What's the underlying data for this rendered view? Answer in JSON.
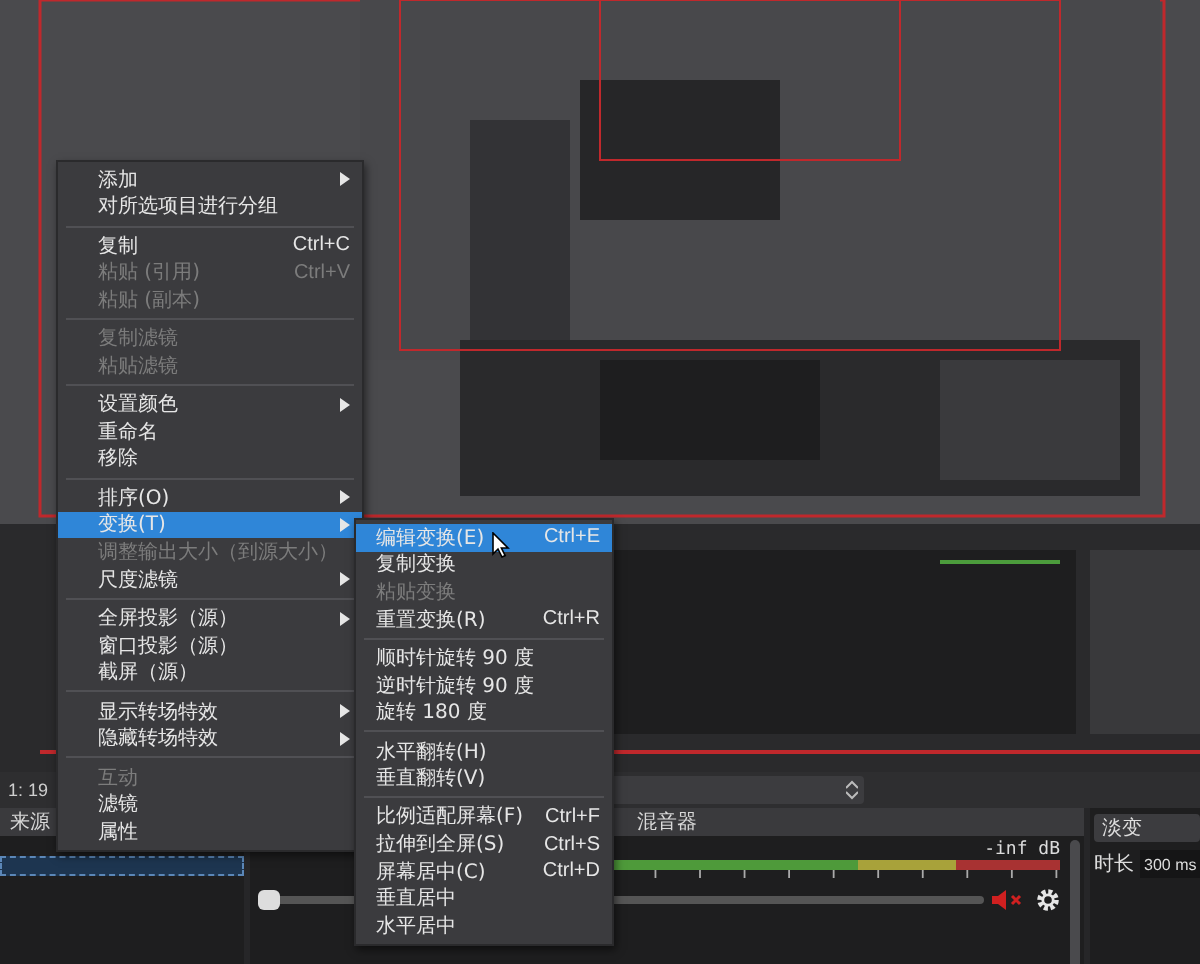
{
  "toolbar": {
    "scene_label": "1: 19"
  },
  "docks": {
    "sources": {
      "title": "来源"
    },
    "mixer": {
      "title": "混音器",
      "reading": "-inf dB",
      "level": 0,
      "muted": true
    },
    "transitions": {
      "transition": "淡变",
      "duration_label": "时长",
      "duration": "300 ms"
    }
  },
  "context_menu": {
    "items": [
      {
        "kind": "item",
        "label": "添加",
        "has_submenu": true,
        "disabled": false,
        "selected": false
      },
      {
        "kind": "item",
        "label": "对所选项目进行分组",
        "has_submenu": false,
        "disabled": false,
        "selected": false
      },
      {
        "kind": "separator"
      },
      {
        "kind": "item",
        "label": "复制",
        "shortcut": "Ctrl+C",
        "has_submenu": false,
        "disabled": false,
        "selected": false
      },
      {
        "kind": "item",
        "label": "粘贴 (引用)",
        "shortcut": "Ctrl+V",
        "has_submenu": false,
        "disabled": true,
        "selected": false
      },
      {
        "kind": "item",
        "label": "粘贴 (副本)",
        "has_submenu": false,
        "disabled": true,
        "selected": false
      },
      {
        "kind": "separator"
      },
      {
        "kind": "item",
        "label": "复制滤镜",
        "has_submenu": false,
        "disabled": true,
        "selected": false
      },
      {
        "kind": "item",
        "label": "粘贴滤镜",
        "has_submenu": false,
        "disabled": true,
        "selected": false
      },
      {
        "kind": "separator"
      },
      {
        "kind": "item",
        "label": "设置颜色",
        "has_submenu": true,
        "disabled": false,
        "selected": false
      },
      {
        "kind": "item",
        "label": "重命名",
        "has_submenu": false,
        "disabled": false,
        "selected": false
      },
      {
        "kind": "item",
        "label": "移除",
        "has_submenu": false,
        "disabled": false,
        "selected": false
      },
      {
        "kind": "separator"
      },
      {
        "kind": "item",
        "label": "排序(O)",
        "has_submenu": true,
        "disabled": false,
        "selected": false
      },
      {
        "kind": "item",
        "label": "变换(T)",
        "has_submenu": true,
        "disabled": false,
        "selected": true
      },
      {
        "kind": "item",
        "label": "调整输出大小（到源大小）",
        "has_submenu": false,
        "disabled": true,
        "selected": false
      },
      {
        "kind": "item",
        "label": "尺度滤镜",
        "has_submenu": true,
        "disabled": false,
        "selected": false
      },
      {
        "kind": "separator"
      },
      {
        "kind": "item",
        "label": "全屏投影（源）",
        "has_submenu": true,
        "disabled": false,
        "selected": false
      },
      {
        "kind": "item",
        "label": "窗口投影（源）",
        "has_submenu": false,
        "disabled": false,
        "selected": false
      },
      {
        "kind": "item",
        "label": "截屏（源）",
        "has_submenu": false,
        "disabled": false,
        "selected": false
      },
      {
        "kind": "separator"
      },
      {
        "kind": "item",
        "label": "显示转场特效",
        "has_submenu": true,
        "disabled": false,
        "selected": false
      },
      {
        "kind": "item",
        "label": "隐藏转场特效",
        "has_submenu": true,
        "disabled": false,
        "selected": false
      },
      {
        "kind": "separator"
      },
      {
        "kind": "item",
        "label": "互动",
        "has_submenu": false,
        "disabled": true,
        "selected": false
      },
      {
        "kind": "item",
        "label": "滤镜",
        "has_submenu": false,
        "disabled": false,
        "selected": false
      },
      {
        "kind": "item",
        "label": "属性",
        "has_submenu": false,
        "disabled": false,
        "selected": false
      }
    ]
  },
  "submenu": {
    "items": [
      {
        "kind": "item",
        "label": "编辑变换(E)",
        "shortcut": "Ctrl+E",
        "disabled": false,
        "selected": true
      },
      {
        "kind": "item",
        "label": "复制变换",
        "disabled": false,
        "selected": false
      },
      {
        "kind": "item",
        "label": "粘贴变换",
        "disabled": true,
        "selected": false
      },
      {
        "kind": "item",
        "label": "重置变换(R)",
        "shortcut": "Ctrl+R",
        "disabled": false,
        "selected": false
      },
      {
        "kind": "separator"
      },
      {
        "kind": "item",
        "label": "顺时针旋转 90 度",
        "disabled": false,
        "selected": false
      },
      {
        "kind": "item",
        "label": "逆时针旋转 90 度",
        "disabled": false,
        "selected": false
      },
      {
        "kind": "item",
        "label": "旋转 180 度",
        "disabled": false,
        "selected": false
      },
      {
        "kind": "separator"
      },
      {
        "kind": "item",
        "label": "水平翻转(H)",
        "disabled": false,
        "selected": false
      },
      {
        "kind": "item",
        "label": "垂直翻转(V)",
        "disabled": false,
        "selected": false
      },
      {
        "kind": "separator"
      },
      {
        "kind": "item",
        "label": "比例适配屏幕(F)",
        "shortcut": "Ctrl+F",
        "disabled": false,
        "selected": false
      },
      {
        "kind": "item",
        "label": "拉伸到全屏(S)",
        "shortcut": "Ctrl+S",
        "disabled": false,
        "selected": false
      },
      {
        "kind": "item",
        "label": "屏幕居中(C)",
        "shortcut": "Ctrl+D",
        "disabled": false,
        "selected": false
      },
      {
        "kind": "item",
        "label": "垂直居中",
        "disabled": false,
        "selected": false
      },
      {
        "kind": "item",
        "label": "水平居中",
        "disabled": false,
        "selected": false
      }
    ]
  }
}
